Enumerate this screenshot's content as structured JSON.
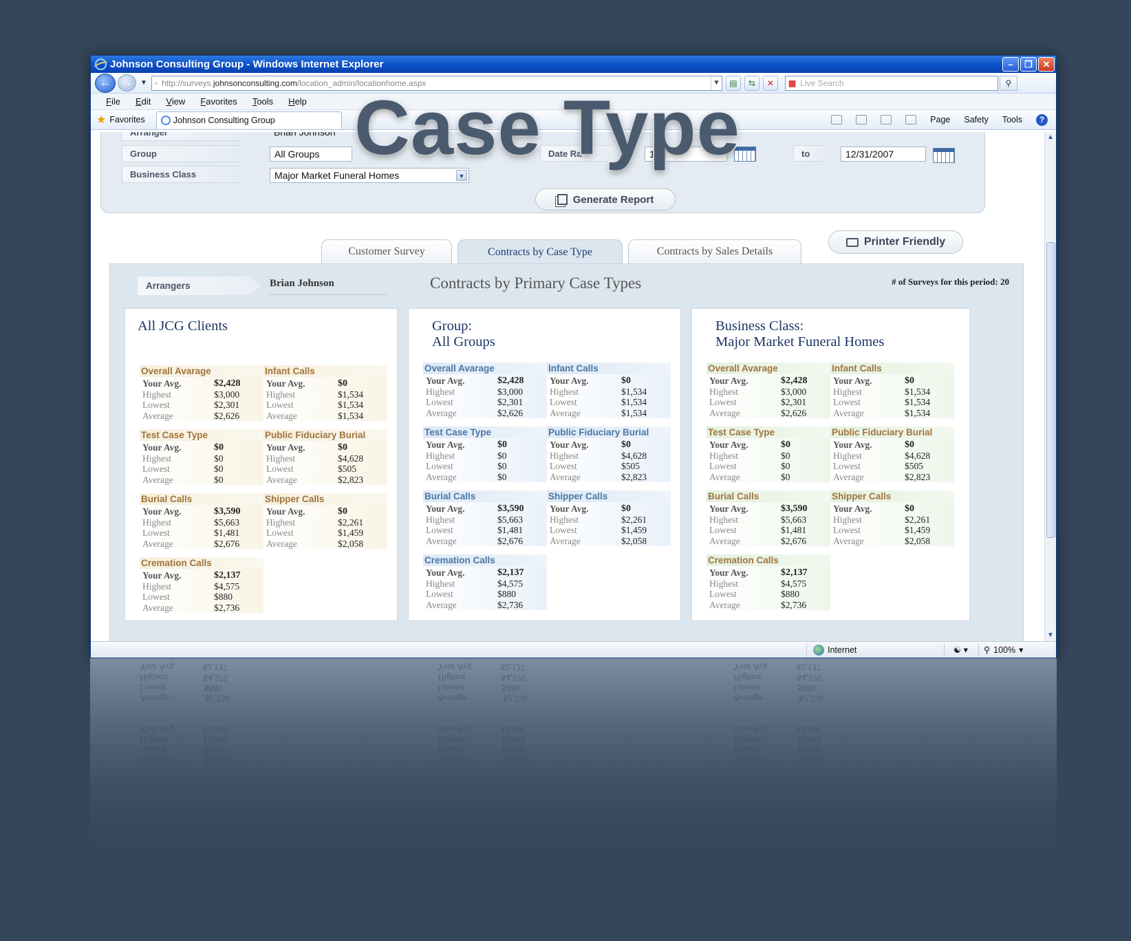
{
  "window": {
    "title": "Johnson Consulting Group - Windows Internet Explorer"
  },
  "address": {
    "url_prefix": "http://surveys.",
    "url_domain": "johnsonconsulting.com",
    "url_path": "/location_admin/locationhome.aspx",
    "search_placeholder": "Live Search"
  },
  "menu": [
    "File",
    "Edit",
    "View",
    "Favorites",
    "Tools",
    "Help"
  ],
  "favorites": {
    "label": "Favorites",
    "tab_title": "Johnson Consulting Group"
  },
  "commands": {
    "page": "Page",
    "safety": "Safety",
    "tools": "Tools"
  },
  "overlay_title": "Case Type",
  "filters": {
    "arranger_label": "Arranger",
    "arranger_value": "Brian Johnson",
    "group_label": "Group",
    "group_value": "All Groups",
    "class_label": "Business Class",
    "class_value": "Major Market Funeral Homes",
    "date_label": "Date Ra",
    "date_from": "1/2",
    "to_label": "to",
    "date_to": "12/31/2007",
    "generate": "Generate Report"
  },
  "printer_friendly": "Printer Friendly",
  "tabs": [
    "Customer Survey",
    "Contracts by Case Type",
    "Contracts by Sales Details"
  ],
  "report": {
    "arrangers_label": "Arrangers",
    "arranger_name": "Brian Johnson",
    "title": "Contracts by Primary Case Types",
    "count_text": "# of Surveys for this period: 20"
  },
  "row_labels": [
    "Your Avg.",
    "Highest",
    "Lowest",
    "Average"
  ],
  "cards": [
    {
      "title_lines": [
        "All JCG Clients",
        ""
      ],
      "style": "tan",
      "stats": [
        {
          "name": "Overall Avarage",
          "values": [
            "$2,428",
            "$3,000",
            "$2,301",
            "$2,626"
          ]
        },
        {
          "name": "Infant Calls",
          "values": [
            "$0",
            "$1,534",
            "$1,534",
            "$1,534"
          ]
        },
        {
          "name": "Test Case Type",
          "values": [
            "$0",
            "$0",
            "$0",
            "$0"
          ]
        },
        {
          "name": "Public Fiduciary Burial",
          "values": [
            "$0",
            "$4,628",
            "$505",
            "$2,823"
          ]
        },
        {
          "name": "Burial Calls",
          "values": [
            "$3,590",
            "$5,663",
            "$1,481",
            "$2,676"
          ]
        },
        {
          "name": "Shipper Calls",
          "values": [
            "$0",
            "$2,261",
            "$1,459",
            "$2,058"
          ]
        },
        {
          "name": "Cremation Calls",
          "values": [
            "$2,137",
            "$4,575",
            "$880",
            "$2,736"
          ]
        }
      ]
    },
    {
      "title_lines": [
        "Group:",
        "All Groups"
      ],
      "style": "blue",
      "stats": [
        {
          "name": "Overall Avarage",
          "values": [
            "$2,428",
            "$3,000",
            "$2,301",
            "$2,626"
          ]
        },
        {
          "name": "Infant Calls",
          "values": [
            "$0",
            "$1,534",
            "$1,534",
            "$1,534"
          ]
        },
        {
          "name": "Test Case Type",
          "values": [
            "$0",
            "$0",
            "$0",
            "$0"
          ]
        },
        {
          "name": "Public Fiduciary Burial",
          "values": [
            "$0",
            "$4,628",
            "$505",
            "$2,823"
          ]
        },
        {
          "name": "Burial Calls",
          "values": [
            "$3,590",
            "$5,663",
            "$1,481",
            "$2,676"
          ]
        },
        {
          "name": "Shipper Calls",
          "values": [
            "$0",
            "$2,261",
            "$1,459",
            "$2,058"
          ]
        },
        {
          "name": "Cremation Calls",
          "values": [
            "$2,137",
            "$4,575",
            "$880",
            "$2,736"
          ]
        }
      ]
    },
    {
      "title_lines": [
        "Business Class:",
        "Major Market Funeral Homes"
      ],
      "style": "green",
      "stats": [
        {
          "name": "Overall Avarage",
          "values": [
            "$2,428",
            "$3,000",
            "$2,301",
            "$2,626"
          ]
        },
        {
          "name": "Infant Calls",
          "values": [
            "$0",
            "$1,534",
            "$1,534",
            "$1,534"
          ]
        },
        {
          "name": "Test Case Type",
          "values": [
            "$0",
            "$0",
            "$0",
            "$0"
          ]
        },
        {
          "name": "Public Fiduciary Burial",
          "values": [
            "$0",
            "$4,628",
            "$505",
            "$2,823"
          ]
        },
        {
          "name": "Burial Calls",
          "values": [
            "$3,590",
            "$5,663",
            "$1,481",
            "$2,676"
          ]
        },
        {
          "name": "Shipper Calls",
          "values": [
            "$0",
            "$2,261",
            "$1,459",
            "$2,058"
          ]
        },
        {
          "name": "Cremation Calls",
          "values": [
            "$2,137",
            "$4,575",
            "$880",
            "$2,736"
          ]
        }
      ]
    }
  ],
  "status": {
    "zone": "Internet",
    "zoom": "100%"
  }
}
